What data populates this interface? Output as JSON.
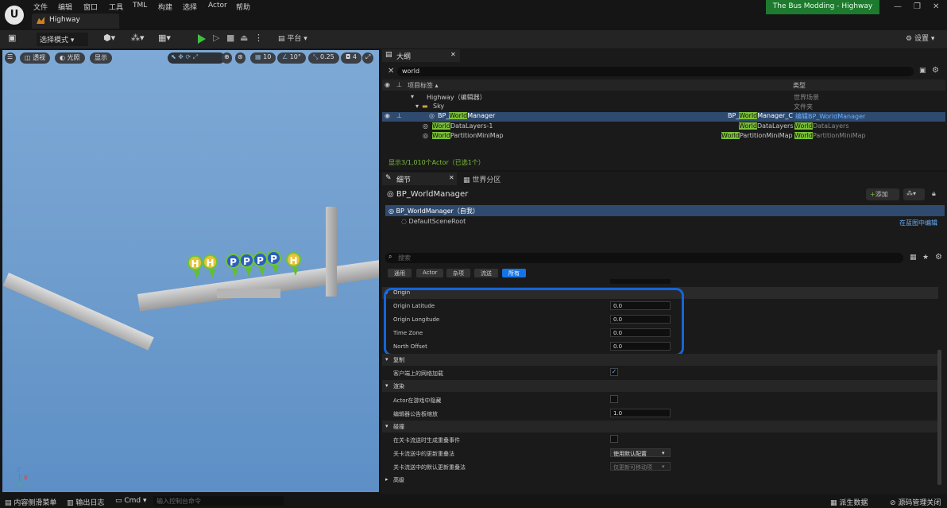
{
  "menu": [
    "文件",
    "编辑",
    "窗口",
    "工具",
    "TML",
    "构建",
    "选择",
    "Actor",
    "帮助"
  ],
  "level_tab": "Highway",
  "project_title": "The Bus Modding - Highway",
  "toolbar": {
    "select_mode": "选择模式",
    "platform": "平台",
    "settings": "设置"
  },
  "viewport": {
    "buttons": [
      "透视",
      "光照",
      "显示"
    ],
    "grid_snap": "10",
    "rot_snap": "10°",
    "scale_snap": "0.25",
    "cam_speed": "4",
    "axis": {
      "z": "Z",
      "x": "X",
      "y": "Y"
    }
  },
  "outliner": {
    "tab": "大纲",
    "search": "world",
    "col_label": "项目标签",
    "col_type": "类型",
    "rows": [
      {
        "label": "Highway（编辑器）",
        "type": "世界场景"
      },
      {
        "label": "Sky",
        "type": "文件夹"
      },
      {
        "pre": "BP_",
        "hl": "World",
        "post": "Manager",
        "tpre": "BP_",
        "thl": "World",
        "tpost": "Manager_C",
        "type_link": "编辑BP_WorldManager"
      },
      {
        "hl": "World",
        "post": "DataLayers-1",
        "thl": "World",
        "tpost": "DataLayers",
        "type_hl": "World",
        "type_post": "DataLayers"
      },
      {
        "hl": "World",
        "post": "PartitionMiniMap",
        "thl": "World",
        "tpost": "PartitionMiniMap",
        "type_hl": "World",
        "type_post": "PartitionMiniMap"
      }
    ],
    "status": "显示3/1,010个Actor（已选1个）"
  },
  "details": {
    "tab": "细节",
    "tab2": "世界分区",
    "actor_name": "BP_WorldManager",
    "add_label": "添加",
    "self_component": "BP_WorldManager（自我）",
    "root_component": "DefaultSceneRoot",
    "edit_in_bp": "在蓝图中编辑",
    "search_placeholder": "搜索",
    "filters": [
      "通用",
      "Actor",
      "杂项",
      "流送",
      "所有"
    ],
    "categories": {
      "origin": "Origin",
      "replication": "复制",
      "rendering": "渲染",
      "collision": "碰撞",
      "advanced": "高级"
    },
    "props": {
      "origin_lat": {
        "label": "Origin Latitude",
        "value": "0.0"
      },
      "origin_lon": {
        "label": "Origin Longitude",
        "value": "0.0"
      },
      "time_zone": {
        "label": "Time Zone",
        "value": "0.0"
      },
      "north_offset": {
        "label": "North Offset",
        "value": "0.0"
      },
      "net_load": {
        "label": "客户端上的网络加载"
      },
      "hidden_in_game": {
        "label": "Actor在游戏中隐藏"
      },
      "billboard_scale": {
        "label": "编辑器公告板缩放",
        "value": "1.0"
      },
      "gen_overlap": {
        "label": "在关卡流送时生成重叠事件"
      },
      "update_overlap": {
        "label": "关卡流送中的更新重叠法",
        "value": "使用默认配置"
      },
      "default_overlap": {
        "label": "关卡流送中的默认更新重叠法",
        "value": "仅更新可移动项"
      }
    }
  },
  "status_bar": {
    "content_drawer": "内容侧滑菜单",
    "output_log": "输出日志",
    "cmd": "Cmd",
    "cmd_placeholder": "输入控制台命令",
    "derived_data": "派生数据",
    "source_control": "源码管理关闭"
  },
  "colors": {
    "highlight": "#7bc03a",
    "annotation": "#1565d8",
    "project": "#1d7a2e",
    "sky": "#6f9dcd"
  }
}
